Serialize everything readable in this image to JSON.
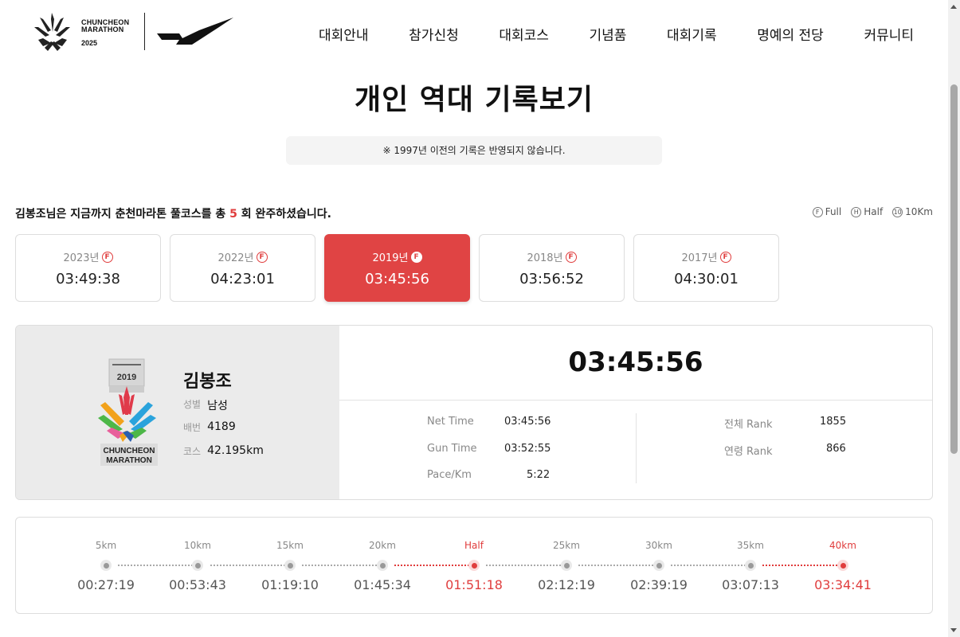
{
  "logo": {
    "line1": "CHUNCHEON",
    "line2": "MARATHON",
    "year": "2025"
  },
  "nav": [
    "대회안내",
    "참가신청",
    "대회코스",
    "기념품",
    "대회기록",
    "명예의 전당",
    "커뮤니티"
  ],
  "title": "개인 역대 기록보기",
  "notice": "※ 1997년 이전의 기록은 반영되지 않습니다.",
  "summary": {
    "prefix": "김봉조님은 지금까지 춘천마라톤 풀코스를 총",
    "count": "5",
    "suffix": "회 완주하셨습니다."
  },
  "legend": [
    {
      "icon": "F",
      "label": "Full"
    },
    {
      "icon": "H",
      "label": "Half"
    },
    {
      "icon": "10",
      "label": "10Km"
    }
  ],
  "years": [
    {
      "year": "2023년",
      "badge": "F",
      "time": "03:49:38",
      "active": false
    },
    {
      "year": "2022년",
      "badge": "F",
      "time": "04:23:01",
      "active": false
    },
    {
      "year": "2019년",
      "badge": "F",
      "time": "03:45:56",
      "active": true
    },
    {
      "year": "2018년",
      "badge": "F",
      "time": "03:56:52",
      "active": false
    },
    {
      "year": "2017년",
      "badge": "F",
      "time": "04:30:01",
      "active": false
    }
  ],
  "medal": {
    "year": "2019",
    "line1": "CHUNCHEON",
    "line2": "MARATHON"
  },
  "runner": {
    "name": "김봉조",
    "gender_label": "성별",
    "gender": "남성",
    "bib_label": "배번",
    "bib": "4189",
    "course_label": "코스",
    "course": "42.195km"
  },
  "record": {
    "total_time": "03:45:56",
    "net_time_label": "Net Time",
    "net_time": "03:45:56",
    "gun_time_label": "Gun Time",
    "gun_time": "03:52:55",
    "pace_label": "Pace/Km",
    "pace": "5:22",
    "overall_rank_label": "전체 Rank",
    "overall_rank": "1855",
    "age_rank_label": "연령 Rank",
    "age_rank": "866"
  },
  "splits": [
    {
      "label": "5km",
      "time": "00:27:19",
      "highlight": false
    },
    {
      "label": "10km",
      "time": "00:53:43",
      "highlight": false
    },
    {
      "label": "15km",
      "time": "01:19:10",
      "highlight": false
    },
    {
      "label": "20km",
      "time": "01:45:34",
      "highlight": false
    },
    {
      "label": "Half",
      "time": "01:51:18",
      "highlight": true
    },
    {
      "label": "25km",
      "time": "02:12:19",
      "highlight": false
    },
    {
      "label": "30km",
      "time": "02:39:19",
      "highlight": false
    },
    {
      "label": "35km",
      "time": "03:07:13",
      "highlight": false
    },
    {
      "label": "40km",
      "time": "03:34:41",
      "highlight": true
    }
  ],
  "colors": {
    "accent": "#e04444",
    "highlight_text": "#e03d3d"
  }
}
